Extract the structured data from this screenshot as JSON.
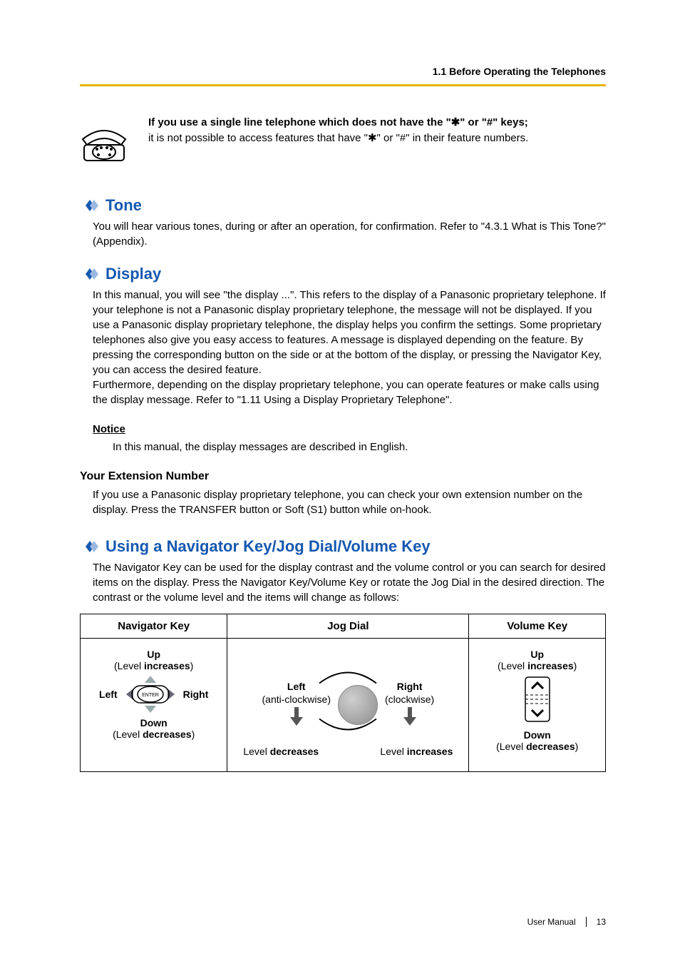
{
  "header": "1.1 Before Operating the Telephones",
  "intro": {
    "bold_line": "If you use a single line telephone which does not have the \"✱\" or \"#\" keys;",
    "line2": "it is not possible to access features that have \"✱\" or \"#\" in their feature numbers."
  },
  "sections": {
    "tone": {
      "title": "Tone",
      "body": "You will hear various tones, during or after an operation, for confirmation. Refer to \"4.3.1 What is This Tone?\" (Appendix)."
    },
    "display": {
      "title": "Display",
      "body": "In this manual, you will see \"the display ...\". This refers to the display of a Panasonic proprietary telephone. If your telephone is not a Panasonic display proprietary telephone, the message will not be displayed. If you use a Panasonic display proprietary telephone, the display helps you confirm the settings. Some proprietary telephones also give you easy access to features. A message is displayed depending on the feature. By pressing the corresponding button on the side or at the bottom of the display, or pressing the Navigator Key, you can access the desired feature.\nFurthermore, depending on the display proprietary telephone, you can operate features or make calls using the display message. Refer to \"1.11 Using a Display Proprietary Telephone\".",
      "notice_heading": "Notice",
      "notice_body": "In this manual, the display messages are described in English.",
      "ext_heading": "Your Extension Number",
      "ext_body": "If you use a Panasonic display proprietary telephone, you can check your own extension number on the display. Press the TRANSFER button or Soft (S1) button while on-hook."
    },
    "navigator": {
      "title": "Using a Navigator Key/Jog Dial/Volume Key",
      "body": "The Navigator Key can be used for the display contrast and the volume control or you can search for desired items on the display. Press the Navigator Key/Volume Key or rotate the Jog Dial in the desired direction. The contrast or the volume level and the items will change as follows:"
    }
  },
  "table": {
    "headers": [
      "Navigator Key",
      "Jog Dial",
      "Volume Key"
    ],
    "nav": {
      "up": "Up",
      "up_sub_pre": "(Level ",
      "up_sub_bold": "increases",
      "up_sub_post": ")",
      "left": "Left",
      "right": "Right",
      "enter": "ENTER",
      "down": "Down",
      "down_sub_pre": "(Level ",
      "down_sub_bold": "decreases",
      "down_sub_post": ")"
    },
    "jog": {
      "left_label": "Left",
      "left_sub": "(anti-clockwise)",
      "right_label": "Right",
      "right_sub": "(clockwise)",
      "left_effect_pre": "Level ",
      "left_effect_bold": "decreases",
      "right_effect_pre": "Level ",
      "right_effect_bold": "increases"
    },
    "vol": {
      "up": "Up",
      "up_sub_pre": "(Level ",
      "up_sub_bold": "increases",
      "up_sub_post": ")",
      "down": "Down",
      "down_sub_pre": "(Level ",
      "down_sub_bold": "decreases",
      "down_sub_post": ")"
    }
  },
  "footer": {
    "label": "User Manual",
    "page": "13"
  }
}
